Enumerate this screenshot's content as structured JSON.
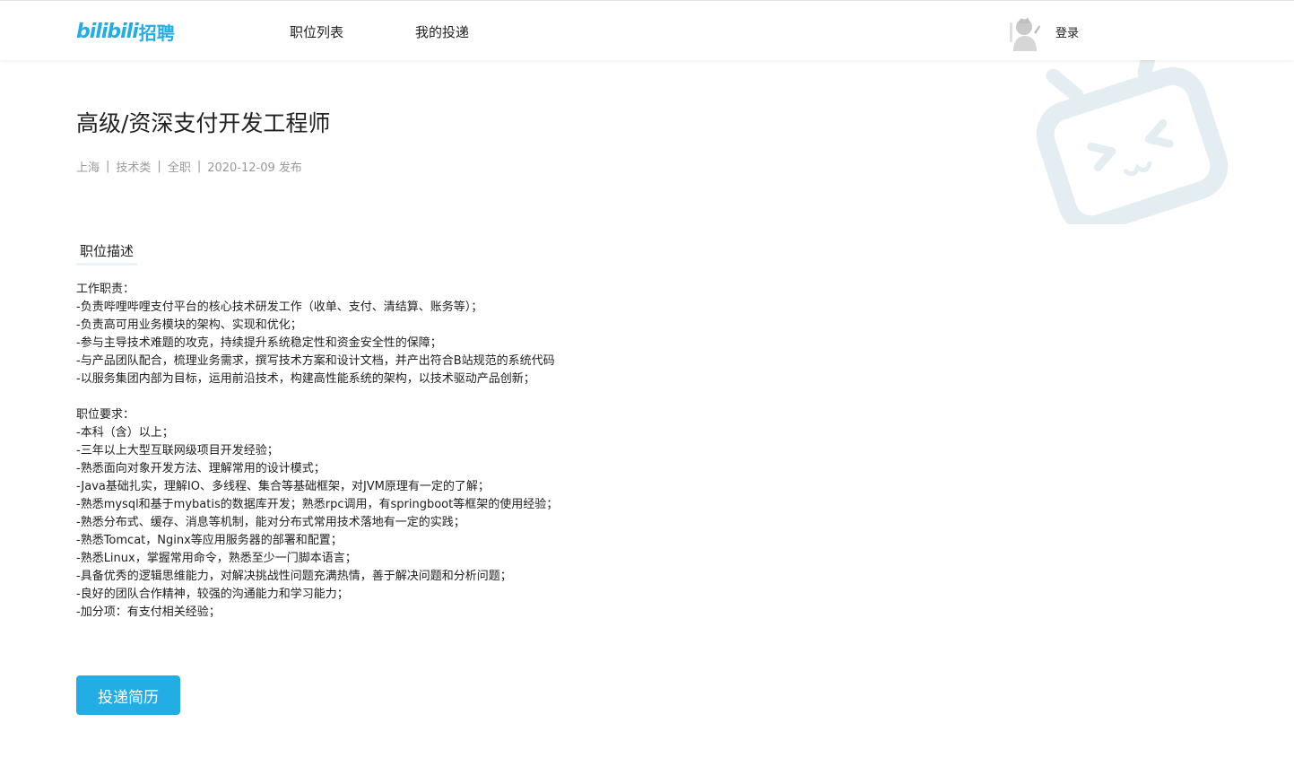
{
  "header": {
    "logo_brand": "bilibili",
    "logo_suffix": "招聘",
    "nav": [
      {
        "label": "职位列表"
      },
      {
        "label": "我的投递"
      }
    ],
    "login_label": "登录"
  },
  "job": {
    "title": "高级/资深支付开发工程师",
    "meta": {
      "city": "上海",
      "category": "技术类",
      "type": "全职",
      "published": "2020-12-09 发布",
      "separator": "|"
    },
    "section_label": "职位描述",
    "responsibilities": {
      "heading": "工作职责：",
      "items": [
        "-负责哔哩哔哩支付平台的核心技术研发工作（收单、支付、清结算、账务等）；",
        "-负责高可用业务模块的架构、实现和优化；",
        "-参与主导技术难题的攻克，持续提升系统稳定性和资金安全性的保障；",
        "-与产品团队配合，梳理业务需求，撰写技术方案和设计文档，并产出符合B站规范的系统代码",
        "-以服务集团内部为目标，运用前沿技术，构建高性能系统的架构，以技术驱动产品创新；"
      ]
    },
    "requirements": {
      "heading": "职位要求：",
      "items": [
        "-本科（含）以上；",
        "-三年以上大型互联网级项目开发经验；",
        "-熟悉面向对象开发方法、理解常用的设计模式；",
        "-Java基础扎实，理解IO、多线程、集合等基础框架，对JVM原理有一定的了解；",
        "-熟悉mysql和基于mybatis的数据库开发；熟悉rpc调用，有springboot等框架的使用经验；",
        "-熟悉分布式、缓存、消息等机制，能对分布式常用技术落地有一定的实践；",
        "-熟悉Tomcat，Nginx等应用服务器的部署和配置；",
        "-熟悉Linux，掌握常用命令，熟悉至少一门脚本语言；",
        "-具备优秀的逻辑思维能力，对解决挑战性问题充满热情，善于解决问题和分析问题；",
        "-良好的团队合作精神，较强的沟通能力和学习能力；",
        "-加分项：有支付相关经验；"
      ]
    },
    "apply_button": "投递简历"
  },
  "colors": {
    "brand": "#23ade5",
    "text": "#212121",
    "meta": "#999999",
    "deco": "#e4eef2"
  },
  "icons": {
    "avatar": "user-avatar-icon",
    "decoration": "bilibili-tv-mascot-icon"
  }
}
